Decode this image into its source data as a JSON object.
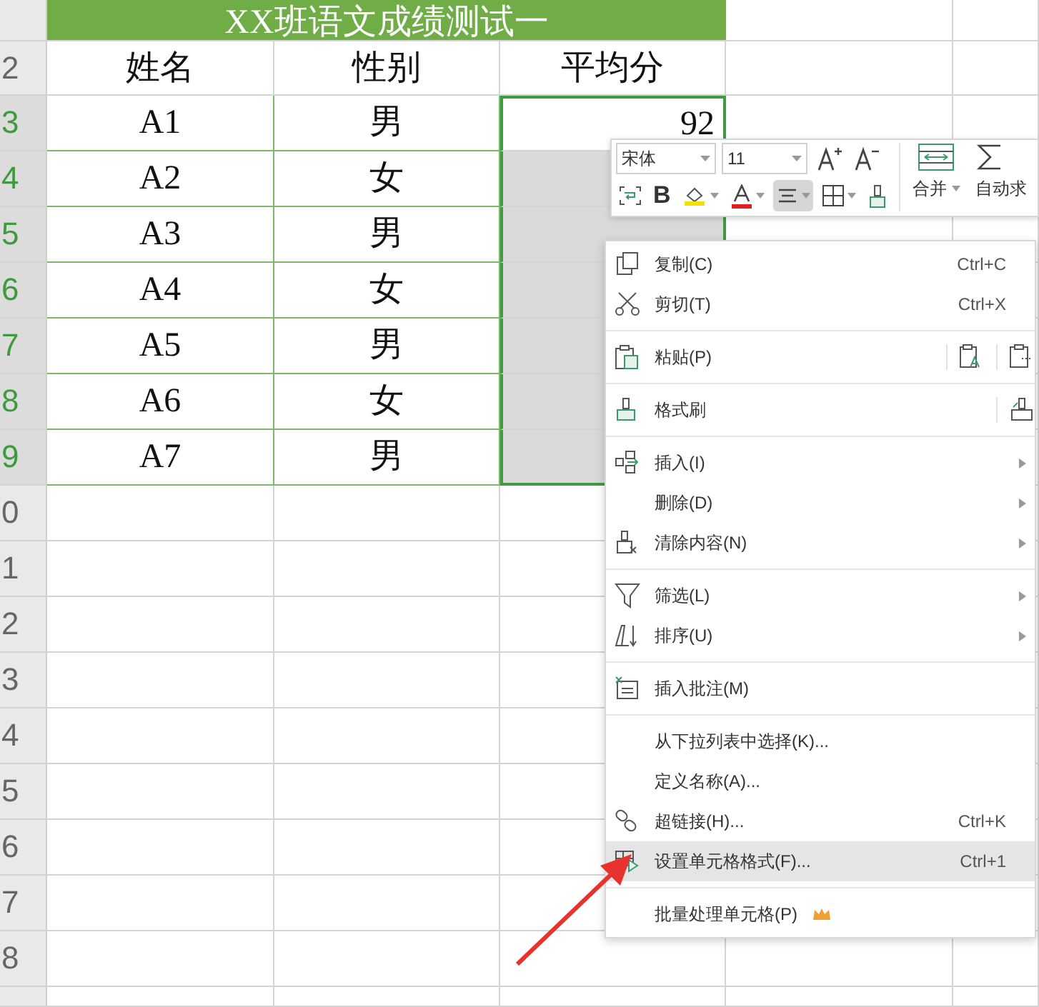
{
  "sheet": {
    "title": "XX班语文成绩测试一",
    "header_row": {
      "row_header": "2",
      "columns": [
        "姓名",
        "性别",
        "平均分"
      ]
    },
    "rows": [
      {
        "row_header": "3",
        "name": "A1",
        "gender": "男",
        "average": "92",
        "selected": true,
        "active": true
      },
      {
        "row_header": "4",
        "name": "A2",
        "gender": "女",
        "selected": true,
        "active": false
      },
      {
        "row_header": "5",
        "name": "A3",
        "gender": "男",
        "selected": true,
        "active": false
      },
      {
        "row_header": "6",
        "name": "A4",
        "gender": "女",
        "selected": true,
        "active": false
      },
      {
        "row_header": "7",
        "name": "A5",
        "gender": "男",
        "selected": true,
        "active": false
      },
      {
        "row_header": "8",
        "name": "A6",
        "gender": "女",
        "selected": true,
        "active": false
      },
      {
        "row_header": "9",
        "name": "A7",
        "gender": "男",
        "selected": true,
        "active": false
      }
    ],
    "empty_row_headers": [
      "0",
      "1",
      "2",
      "3",
      "4",
      "5",
      "6",
      "7",
      "8"
    ]
  },
  "mini_toolbar": {
    "font": "宋体",
    "font_size": "11",
    "bold": "B",
    "align_pressed": true,
    "merge": "合并",
    "autosum": "自动求"
  },
  "context_menu": [
    {
      "kind": "item",
      "label": "复制(C)",
      "shortcut": "Ctrl+C",
      "submenu": false,
      "selected": false
    },
    {
      "kind": "item",
      "label": "剪切(T)",
      "shortcut": "Ctrl+X",
      "submenu": false,
      "selected": false
    },
    {
      "kind": "separator"
    },
    {
      "kind": "item",
      "label": "粘贴(P)",
      "submenu": false,
      "selected": false
    },
    {
      "kind": "separator"
    },
    {
      "kind": "item",
      "label": "格式刷",
      "submenu": false,
      "selected": false
    },
    {
      "kind": "separator"
    },
    {
      "kind": "item",
      "label": "插入(I)",
      "submenu": true,
      "selected": false
    },
    {
      "kind": "item",
      "label": "删除(D)",
      "submenu": true,
      "selected": false
    },
    {
      "kind": "item",
      "label": "清除内容(N)",
      "submenu": true,
      "selected": false
    },
    {
      "kind": "separator"
    },
    {
      "kind": "item",
      "label": "筛选(L)",
      "submenu": true,
      "selected": false
    },
    {
      "kind": "item",
      "label": "排序(U)",
      "submenu": true,
      "selected": false
    },
    {
      "kind": "separator"
    },
    {
      "kind": "item",
      "label": "插入批注(M)",
      "submenu": false,
      "selected": false
    },
    {
      "kind": "separator"
    },
    {
      "kind": "item",
      "label": "从下拉列表中选择(K)...",
      "submenu": false,
      "selected": false
    },
    {
      "kind": "item",
      "label": "定义名称(A)...",
      "submenu": false,
      "selected": false
    },
    {
      "kind": "item",
      "label": "超链接(H)...",
      "shortcut": "Ctrl+K",
      "submenu": false,
      "selected": false
    },
    {
      "kind": "item",
      "label": "设置单元格格式(F)...",
      "shortcut": "Ctrl+1",
      "submenu": false,
      "selected": true
    },
    {
      "kind": "separator"
    },
    {
      "kind": "item",
      "label": "批量处理单元格(P)",
      "submenu": false,
      "selected": false
    }
  ]
}
